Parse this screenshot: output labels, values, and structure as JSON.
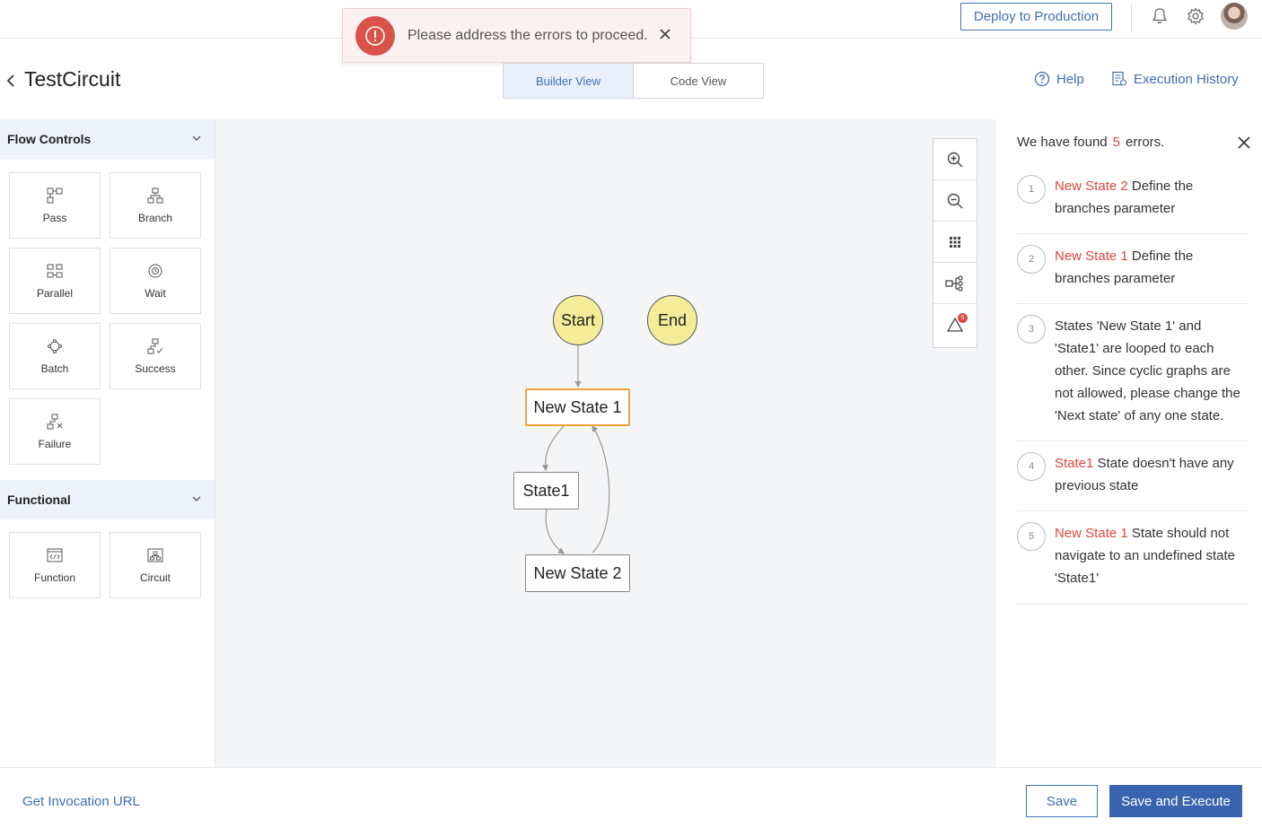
{
  "topbar": {
    "deploy_label": "Deploy to Production",
    "icons": [
      "bell-icon",
      "gear-icon",
      "avatar"
    ]
  },
  "toast": {
    "message": "Please address the errors to proceed.",
    "icon": "error-icon"
  },
  "header": {
    "title": "TestCircuit",
    "views": [
      {
        "label": "Builder View",
        "active": true
      },
      {
        "label": "Code View",
        "active": false
      }
    ],
    "help_label": "Help",
    "history_label": "Execution History"
  },
  "sidebar": {
    "flow_controls": {
      "title": "Flow Controls",
      "items": [
        {
          "label": "Pass",
          "icon": "pass-icon"
        },
        {
          "label": "Branch",
          "icon": "branch-icon"
        },
        {
          "label": "Parallel",
          "icon": "parallel-icon"
        },
        {
          "label": "Wait",
          "icon": "wait-icon"
        },
        {
          "label": "Batch",
          "icon": "batch-icon"
        },
        {
          "label": "Success",
          "icon": "success-icon"
        },
        {
          "label": "Failure",
          "icon": "failure-icon"
        }
      ]
    },
    "functional": {
      "title": "Functional",
      "items": [
        {
          "label": "Function",
          "icon": "function-icon"
        },
        {
          "label": "Circuit",
          "icon": "circuit-icon"
        }
      ]
    }
  },
  "canvas": {
    "toolbar": [
      "zoom-in-icon",
      "zoom-out-icon",
      "grid-icon",
      "layout-icon",
      "alert-icon"
    ],
    "alert_count": "5",
    "nodes": {
      "start": "Start",
      "end": "End",
      "new_state_1": "New State 1",
      "state1": "State1",
      "new_state_2": "New State 2"
    }
  },
  "errors": {
    "prefix": "We have found",
    "count": "5",
    "suffix": "errors.",
    "items": [
      {
        "num": "1",
        "state": "New State 2",
        "text": "Define the branches parameter"
      },
      {
        "num": "2",
        "state": "New State 1",
        "text": "Define the branches parameter"
      },
      {
        "num": "3",
        "state": "",
        "text": "States 'New State 1' and 'State1' are looped to each other. Since cyclic graphs are not allowed, please change the 'Next state' of any one state."
      },
      {
        "num": "4",
        "state": "State1",
        "text": "State doesn't have any previous state"
      },
      {
        "num": "5",
        "state": "New State 1",
        "text": "State should not navigate to an undefined state 'State1'"
      }
    ]
  },
  "footer": {
    "invoke_label": "Get Invocation URL",
    "save_label": "Save",
    "save_execute_label": "Save and Execute"
  },
  "colors": {
    "accent": "#3d6fb5",
    "error": "#e0463c",
    "node_fill": "#f5ec9a",
    "selected_border": "#f0a53a"
  }
}
